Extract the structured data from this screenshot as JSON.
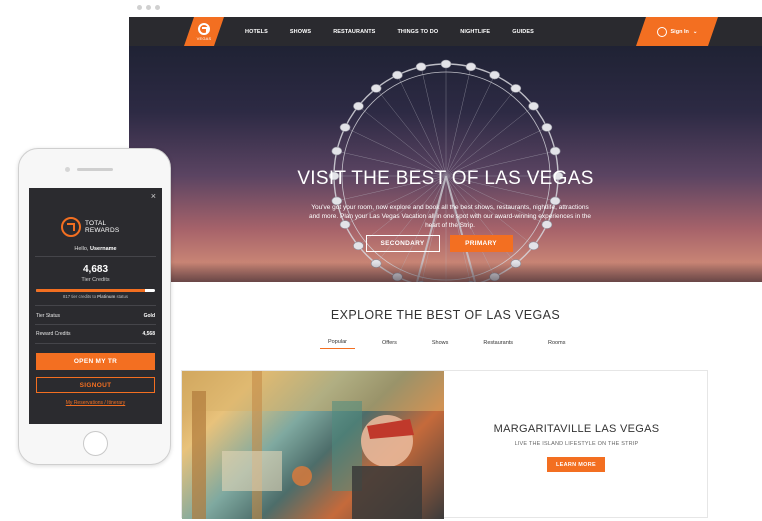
{
  "colors": {
    "accent": "#f36f21",
    "nav_bg": "#2a2a2f",
    "mobile_bg": "#2b2b2f"
  },
  "desktop": {
    "logo": {
      "icon": "total-rewards-logo-icon",
      "text": "VEGAS"
    },
    "nav": {
      "items": [
        "HOTELS",
        "SHOWS",
        "RESTAURANTS",
        "THINGS TO DO",
        "NIGHTLIFE",
        "GUIDES"
      ],
      "sign_in": "Sign In"
    },
    "hero": {
      "title": "VISIT THE BEST OF LAS VEGAS",
      "subtitle": "You've got your room, now explore and book all the best shows, restaurants, nightlife, attractions and more. Plan your Las Vegas Vacation all in one spot with our award-winning experiences in the heart of the Strip.",
      "secondary_label": "SECONDARY",
      "primary_label": "PRIMARY"
    },
    "explore": {
      "title": "EXPLORE THE BEST OF LAS VEGAS",
      "tabs": [
        "Popular",
        "Offers",
        "Shows",
        "Restaurants",
        "Rooms"
      ],
      "active_tab": "Popular"
    },
    "card": {
      "title": "MARGARITAVILLE LAS VEGAS",
      "subtitle": "LIVE THE ISLAND LIFESTYLE ON THE STRIP",
      "button": "LEARN MORE"
    }
  },
  "mobile": {
    "close": "×",
    "brand_line1": "TOTAL",
    "brand_line2": "REWARDS",
    "greeting": "Hello,",
    "username": "Username",
    "tier_credits_value": "4,683",
    "tier_credits_label": "Tier Credits",
    "progress_fraction": 0.92,
    "progress_note_count": "817",
    "progress_note_mid": "tier credits to",
    "progress_note_tier": "Platinum",
    "progress_note_end": "status",
    "tier_status_label": "Tier Status",
    "tier_status_value": "Gold",
    "reward_credits_label": "Reward Credits",
    "reward_credits_value": "4,568",
    "open_button": "OPEN MY TR",
    "signout_button": "SIGNOUT",
    "reservations_link": "My Reservations / Itinerary"
  }
}
